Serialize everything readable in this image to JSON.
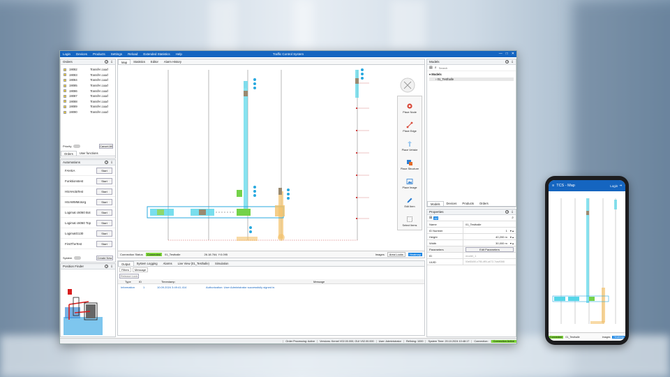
{
  "window": {
    "title": "Traffic Control System",
    "menu": [
      "Login",
      "Devices",
      "Products",
      "Settings",
      "Reload",
      "Extended Statistics",
      "Help"
    ]
  },
  "orders": {
    "title": "Orders",
    "items": [
      {
        "id": "19082",
        "type": "Transfer Load"
      },
      {
        "id": "19083",
        "type": "Transfer Load"
      },
      {
        "id": "19084",
        "type": "Transfer Load"
      },
      {
        "id": "19085",
        "type": "Transfer Load"
      },
      {
        "id": "19086",
        "type": "Transfer Load"
      },
      {
        "id": "19087",
        "type": "Transfer Load"
      },
      {
        "id": "19088",
        "type": "Transfer Load"
      },
      {
        "id": "19089",
        "type": "Transfer Load"
      },
      {
        "id": "19090",
        "type": "Transfer Load"
      }
    ],
    "priority_label": "Priority",
    "cancel_all": "Cancel All",
    "tabs": [
      "Orders",
      "User functions"
    ]
  },
  "automations": {
    "title": "Automations",
    "start_label": "Start",
    "items": [
      "FAHSA",
      "Funktionstest",
      "HSAHolaTest",
      "HSAWMMotorg",
      "Logimat c6060 Bot",
      "Logimat c6060 Top",
      "LogimatG130",
      "FirstTheTest"
    ],
    "system_label": "System",
    "create_new": "Create New"
  },
  "position_finder": {
    "title": "Position Finder"
  },
  "map": {
    "tabs": [
      "Map",
      "Statistics",
      "Editor",
      "Alarm History"
    ],
    "connection_label": "Connection Status",
    "connection_value": "Connected",
    "model_name": "01_Testhalle",
    "coords": "26.18.764; Y:0.095",
    "images_label": "Images",
    "area_locks_label": "Area Locks",
    "heatmap_label": "Heatmap"
  },
  "toolbox": [
    {
      "label": "Place Node",
      "icon": "node-icon",
      "color": "#d94a3a"
    },
    {
      "label": "Place Edge",
      "icon": "edge-icon",
      "color": "#d94a3a"
    },
    {
      "label": "Place Vehicle",
      "icon": "vehicle-icon",
      "color": "#2d7fd3"
    },
    {
      "label": "Place Structure",
      "icon": "structure-icon",
      "color": "#e36c2a"
    },
    {
      "label": "Place Image",
      "icon": "image-icon",
      "color": "#2d7fd3"
    },
    {
      "label": "Edit Item",
      "icon": "pencil-icon",
      "color": "#2d7fd3"
    },
    {
      "label": "Select Items",
      "icon": "select-icon",
      "color": "#555555"
    }
  ],
  "output": {
    "tabs": [
      "Output",
      "System Logging",
      "Alarms",
      "Live View (01_Testhalle)",
      "Simulation"
    ],
    "subtabs": [
      "Filters",
      "Message"
    ],
    "release_lock": "Release Lock",
    "columns": [
      "Type",
      "ID",
      "Timestamp",
      "Message"
    ],
    "rows": [
      {
        "type": "Information",
        "id": "1",
        "timestamp": "10.09.2024 3:49:41.414",
        "message": "Authorization: User Administrator successfully signed in."
      }
    ]
  },
  "models": {
    "title": "Models",
    "search_placeholder": "Search",
    "root": "Models",
    "child": "01_Testhalle",
    "tabs": [
      "Models",
      "Devices",
      "Products",
      "Orders"
    ]
  },
  "properties": {
    "title": "Properties",
    "rows": [
      {
        "key": "Name",
        "value": "01_Testhalle"
      },
      {
        "key": "ID Number",
        "value": "1"
      },
      {
        "key": "Height",
        "value": "40,200 m"
      },
      {
        "key": "Width",
        "value": "30,000 m"
      },
      {
        "key": "Parameters",
        "value": "Edit Parameters"
      },
      {
        "key": "ID",
        "value": "model_1"
      },
      {
        "key": "UUID",
        "value": "53e83450-c755-4f91-a072-7cac9368"
      }
    ]
  },
  "statusbar": {
    "items": [
      "Order Processing: Active",
      "Versions: Kernel V02.00.000; GUI V02.00.000",
      "User: Administrator",
      "Refining: 1000",
      "System Time: 20.10.2024 10:48:17",
      "Connection:"
    ],
    "connection": "Connection Active"
  },
  "phone": {
    "title": "TCS - Map",
    "login": "Login",
    "footer": [
      "Connected",
      "01_Testhalle",
      "Images",
      "Heatmap"
    ]
  }
}
